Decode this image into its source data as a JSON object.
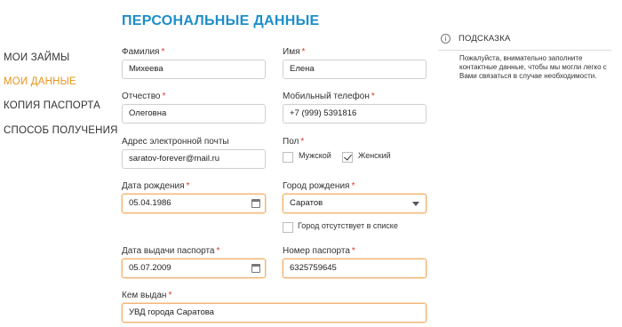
{
  "page": {
    "title": "ПЕРСОНАЛЬНЫЕ ДАННЫЕ"
  },
  "nav": [
    {
      "label": "МОИ ЗАЙМЫ",
      "active": false
    },
    {
      "label": "МОИ ДАННЫЕ",
      "active": true
    },
    {
      "label": "КОПИЯ ПАСПОРТА",
      "active": false
    },
    {
      "label": "СПОСОБ ПОЛУЧЕНИЯ",
      "active": false
    }
  ],
  "form": {
    "required_mark": "*",
    "surname": {
      "label": "Фамилия",
      "value": "Михеева"
    },
    "name": {
      "label": "Имя",
      "value": "Елена"
    },
    "patronymic": {
      "label": "Отчество",
      "value": "Олеговна"
    },
    "phone": {
      "label": "Мобильный телефон",
      "value": "+7 (999) 5391816"
    },
    "email": {
      "label": "Адрес электронной почты",
      "value": "saratov-forever@mail.ru"
    },
    "gender": {
      "label": "Пол",
      "male": "Мужской",
      "female": "Женский",
      "selected": "female"
    },
    "birth_date": {
      "label": "Дата рождения",
      "value": "05.04.1986"
    },
    "birth_city": {
      "label": "Город рождения",
      "value": "Саратов",
      "missing_label": "Город отсутствует в списке"
    },
    "passport_issue_date": {
      "label": "Дата выдачи паспорта",
      "value": "05.07.2009"
    },
    "passport_number": {
      "label": "Номер паспорта",
      "value": "6325759645"
    },
    "issued_by": {
      "label": "Кем выдан",
      "value": "УВД города Саратова"
    }
  },
  "hint": {
    "icon": "info-icon",
    "title": "ПОДСКАЗКА",
    "text": "Пожалуйста, внимательно заполните контактные данные, чтобы мы могли легко с Вами связаться в случае необходимости."
  },
  "colors": {
    "accent": "#1d8ec9",
    "active_nav": "#e8951b",
    "highlight_border": "#f2b473",
    "required": "#e0362c"
  }
}
